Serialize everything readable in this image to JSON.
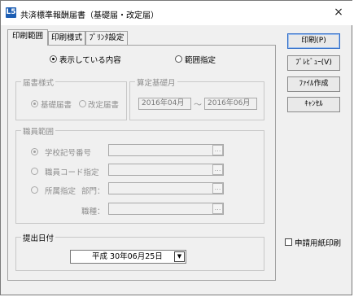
{
  "window": {
    "title": "共済標準報酬届書（基礎届・改定届）",
    "app_icon": "L5",
    "close_glyph": "×"
  },
  "tabs": [
    {
      "label": "印刷範囲",
      "active": true
    },
    {
      "label": "印刷様式",
      "active": false
    },
    {
      "label": "ﾌﾟﾘﾝﾀ設定",
      "active": false
    }
  ],
  "print_scope": {
    "option_all": "表示している内容",
    "option_range": "範囲指定",
    "selected": "all"
  },
  "form_type": {
    "title": "届書様式",
    "option_basic": "基礎届書",
    "option_revision": "改定届書",
    "selected": "basic"
  },
  "calc_month": {
    "title": "算定基礎月",
    "from": "2016年04月",
    "separator": "～",
    "to": "2016年06月"
  },
  "staff_range": {
    "title": "職員範囲",
    "option_school": "学校記号番号",
    "option_staff_code": "職員コード指定",
    "option_affiliation": "所属指定",
    "dept_label": "部門：",
    "type_label": "職種：",
    "dots_glyph": "…"
  },
  "submit_date": {
    "title": "提出日付",
    "value": "平成 30年06月25日",
    "dropdown_glyph": "▼"
  },
  "buttons": {
    "print": "印刷(P)",
    "preview": "ﾌﾟﾚﾋﾞｭｰ(V)",
    "file": "ﾌｧｲﾙ作成",
    "cancel": "ｷｬﾝｾﾙ"
  },
  "apply_form_print": {
    "label": "申請用紙印刷",
    "checked": false
  }
}
